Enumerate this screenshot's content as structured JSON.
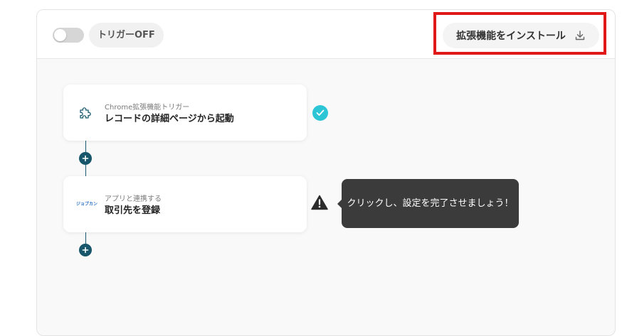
{
  "header": {
    "toggle_state": "off",
    "trigger_label": "トリガーOFF",
    "install_button_label": "拡張機能をインストール",
    "highlight_color": "#e01818"
  },
  "flow": {
    "steps": [
      {
        "subtitle": "Chrome拡張機能トリガー",
        "title": "レコードの詳細ページから起動",
        "icon": "puzzle-icon",
        "status": "complete"
      },
      {
        "subtitle": "アプリと連携する",
        "title": "取引先を登録",
        "icon": "app-logo",
        "app_logo_text": "ジョブカン",
        "status": "warning"
      }
    ],
    "tooltip": "クリックし、設定を完了させましょう！",
    "accent_color": "#17566b",
    "check_color": "#2cc5d6"
  }
}
